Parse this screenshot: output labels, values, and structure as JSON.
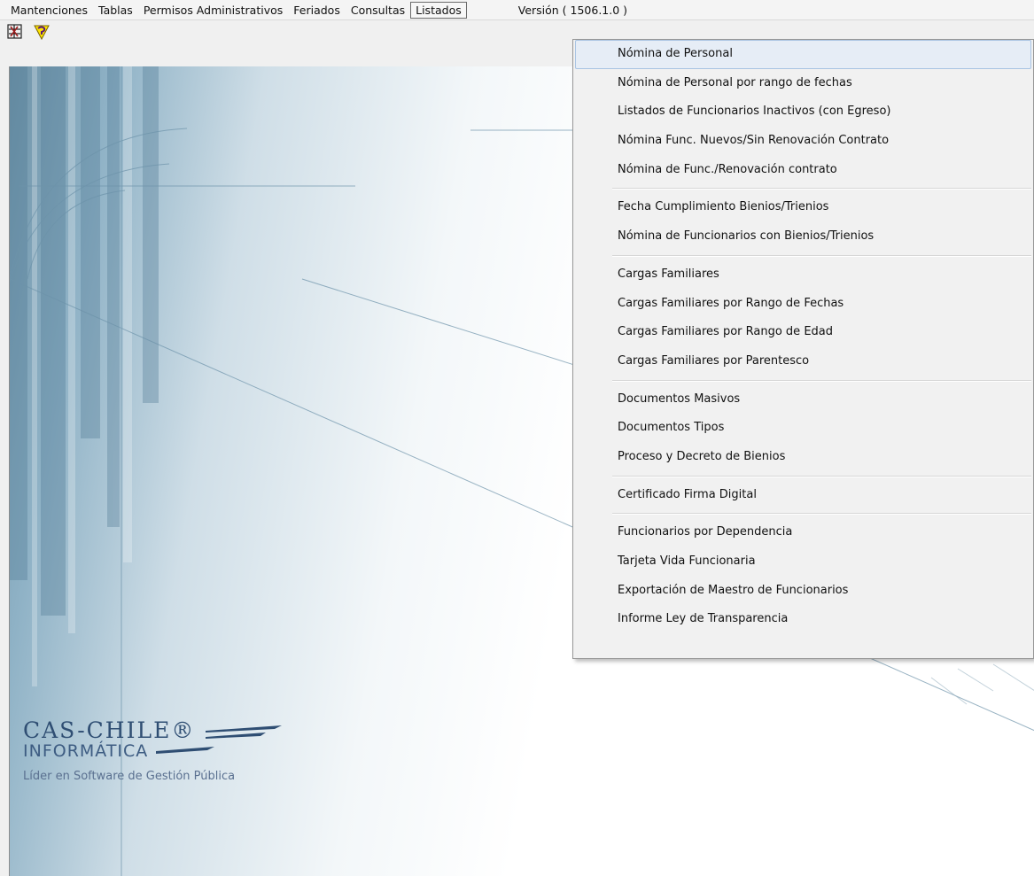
{
  "menubar": {
    "items": [
      "Mantenciones",
      "Tablas",
      "Permisos Administrativos",
      "Feriados",
      "Consultas",
      "Listados"
    ],
    "active": "Listados",
    "version": "Versión ( 1506.1.0 )"
  },
  "toolbar": {
    "buttons": [
      "exit-icon",
      "help-icon"
    ]
  },
  "dropdown": {
    "groups": [
      [
        "Nómina de Personal",
        "Nómina de Personal por rango de fechas",
        "Listados de Funcionarios Inactivos (con Egreso)",
        "Nómina Func. Nuevos/Sin Renovación Contrato",
        "Nómina de Func./Renovación contrato"
      ],
      [
        "Fecha Cumplimiento Bienios/Trienios",
        "Nómina de Funcionarios con Bienios/Trienios"
      ],
      [
        "Cargas Familiares",
        "Cargas Familiares por Rango de Fechas",
        "Cargas Familiares por Rango de Edad",
        "Cargas Familiares por Parentesco"
      ],
      [
        "Documentos Masivos",
        "Documentos Tipos",
        "Proceso y Decreto de Bienios"
      ],
      [
        "Certificado Firma Digital"
      ],
      [
        "Funcionarios por Dependencia",
        "Tarjeta Vida Funcionaria",
        "Exportación de Maestro de Funcionarios",
        "Informe Ley de Transparencia"
      ]
    ],
    "highlighted": "Nómina de Personal"
  },
  "logo": {
    "line1": "CAS-CHILE®",
    "line2": "INFORMÁTICA",
    "tagline": "Líder en Software de Gestión Pública"
  },
  "colors": {
    "menu_bg": "#f4f4f4",
    "dropdown_bg": "#f1f1f1",
    "highlight_bg": "#e6edf6",
    "highlight_border": "#a9c4e3",
    "logo_blue": "#2f4e73"
  }
}
